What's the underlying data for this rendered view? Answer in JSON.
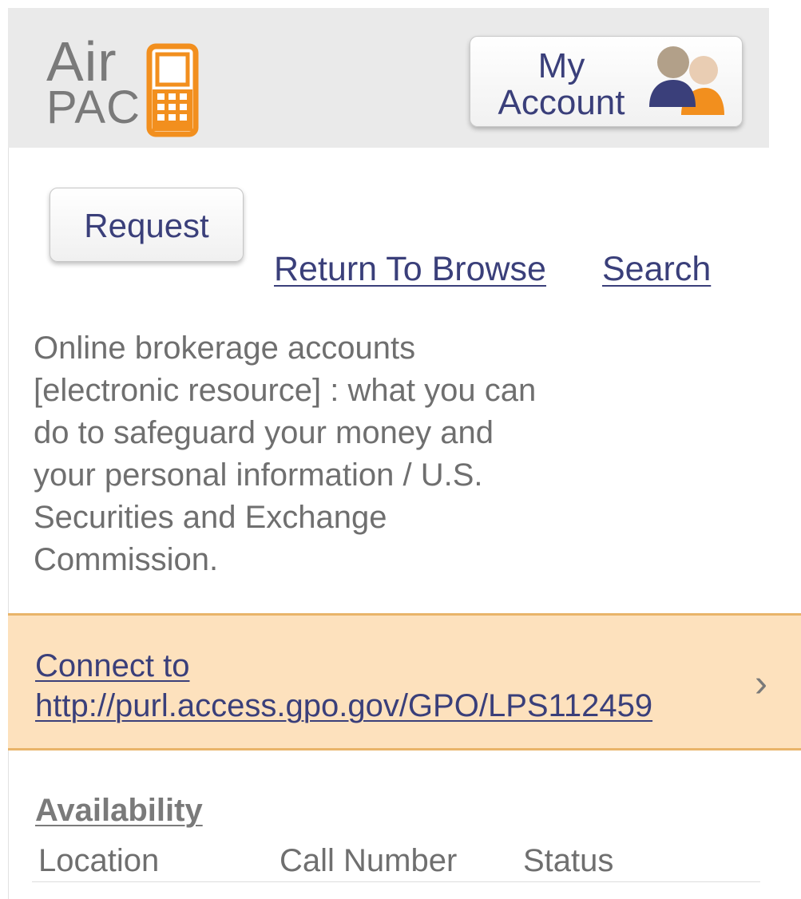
{
  "header": {
    "logo": {
      "line1": "Air",
      "line2": "PAC"
    },
    "account_button": {
      "line1": "My",
      "line2": "Account"
    }
  },
  "actions": {
    "request_label": "Request",
    "return_label": "Return To Browse",
    "search_label": "Search"
  },
  "record": {
    "title": "Online brokerage accounts [electronic resource] : what you can do to safeguard your money and your personal information / U.S. Securities and Exchange Commission."
  },
  "connect": {
    "line1": "Connect to",
    "line2": "http://purl.access.gpo.gov/GPO/LPS112459",
    "chevron": "›"
  },
  "availability": {
    "heading": "Availability",
    "columns": [
      "Location",
      "Call Number",
      "Status"
    ]
  },
  "colors": {
    "header_bg": "#eaeaea",
    "link": "#3a3f7a",
    "logo_orange": "#f28f1e",
    "connect_bg": "#fde1bd",
    "connect_border": "#e9b46a",
    "text_gray": "#6f6f6f"
  },
  "icons": {
    "logo_phone": "phone-icon",
    "account": "people-icon",
    "chevron": "chevron-right-icon"
  }
}
